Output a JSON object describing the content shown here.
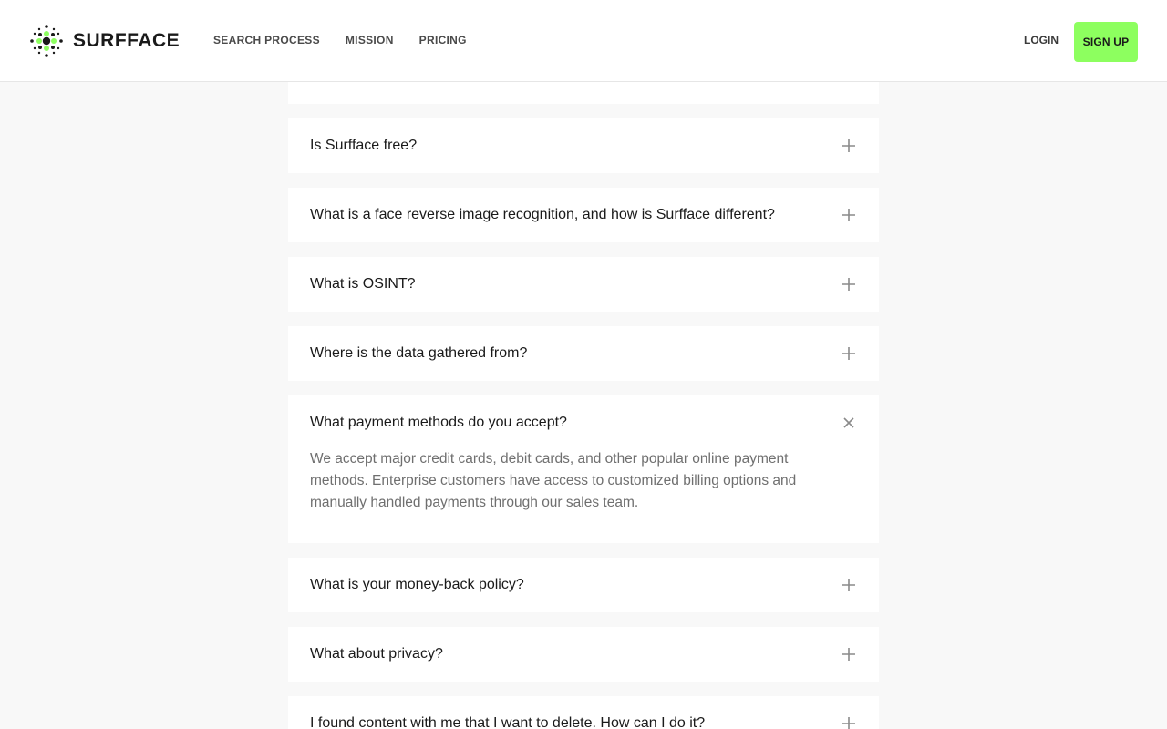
{
  "brand": {
    "name": "SURFFACE",
    "accent": "#8dff5f",
    "icon": "dots-logo-icon"
  },
  "nav": {
    "items": [
      {
        "label": "SEARCH PROCESS"
      },
      {
        "label": "MISSION"
      },
      {
        "label": "PRICING"
      }
    ],
    "login_label": "LOGIN",
    "signup_label": "SIGN UP"
  },
  "faq": {
    "items": [
      {
        "question": "Is Surfface free?",
        "expanded": false,
        "icon": "plus-icon"
      },
      {
        "question": "What is a face reverse image recognition, and how is Surfface different?",
        "expanded": false,
        "icon": "plus-icon"
      },
      {
        "question": "What is OSINT?",
        "expanded": false,
        "icon": "plus-icon"
      },
      {
        "question": "Where is the data gathered from?",
        "expanded": false,
        "icon": "plus-icon"
      },
      {
        "question": "What payment methods do you accept?",
        "expanded": true,
        "icon": "close-icon",
        "answer": "We accept major credit cards, debit cards, and other popular online payment methods. Enterprise customers have access to customized billing options and manually handled payments through our sales team."
      },
      {
        "question": "What is your money-back policy?",
        "expanded": false,
        "icon": "plus-icon"
      },
      {
        "question": "What about privacy?",
        "expanded": false,
        "icon": "plus-icon"
      },
      {
        "question": "I found content with me that I want to delete. How can I do it?",
        "expanded": false,
        "icon": "plus-icon"
      }
    ]
  }
}
